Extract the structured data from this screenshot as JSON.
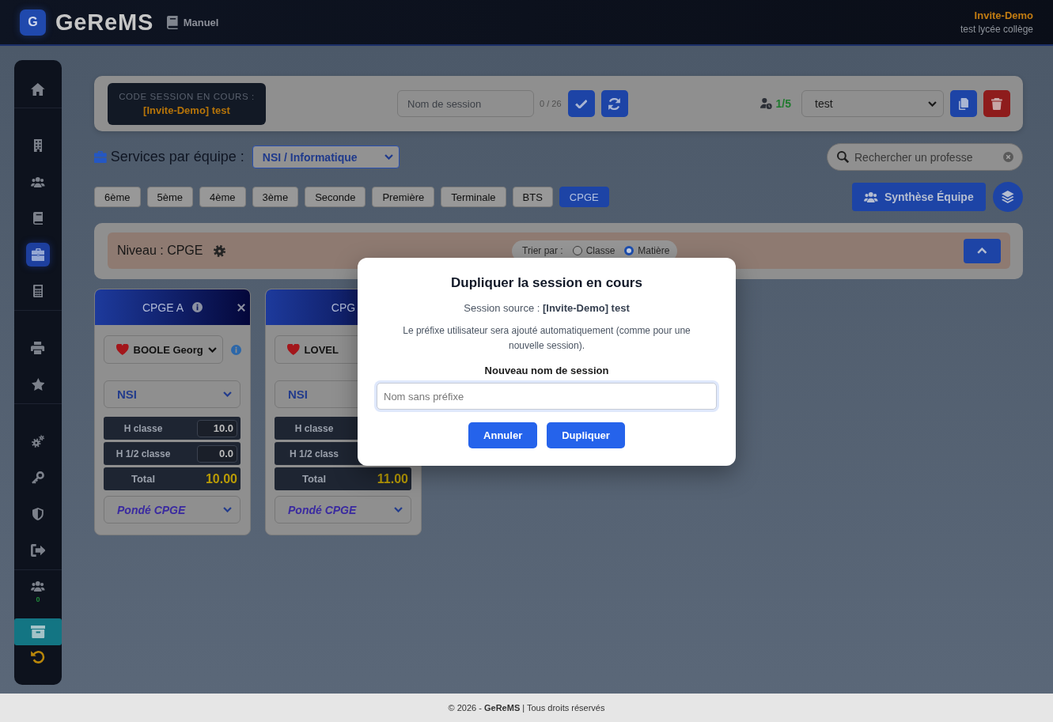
{
  "header": {
    "logo": "G",
    "app_name": "GeReMS",
    "manual_link": "Manuel",
    "user_name": "Invite-Demo",
    "school": "test lycée collège"
  },
  "sidebar": {
    "sections": [
      {
        "items": [
          {
            "kind": "plain",
            "selected": false
          }
        ]
      },
      {
        "items": [
          {
            "kind": "plain",
            "selected": false
          },
          {
            "kind": "plain",
            "selected": false
          },
          {
            "kind": "plain",
            "selected": false
          },
          {
            "kind": "plain",
            "selected": true
          },
          {
            "kind": "plain",
            "selected": false
          }
        ]
      },
      {
        "items": [
          {
            "kind": "plain",
            "selected": false
          },
          {
            "kind": "plain",
            "selected": false
          }
        ]
      },
      {
        "items": [
          {
            "kind": "plain",
            "selected": false
          },
          {
            "kind": "plain",
            "selected": false
          },
          {
            "kind": "plain",
            "selected": false
          },
          {
            "kind": "plain",
            "selected": false
          }
        ]
      },
      {
        "items": [
          {
            "kind": "plain",
            "selected": false,
            "count": "0"
          },
          {
            "kind": "tile",
            "selected": false
          },
          {
            "kind": "warn",
            "selected": false
          }
        ]
      }
    ]
  },
  "session_bar": {
    "code_label": "CODE SESSION EN COURS :",
    "code_value": "[Invite-Demo] test",
    "name_field": {
      "placeholder": "Nom de session"
    },
    "char_count": "0 / 26",
    "user_quota": "1/5",
    "session_select": {
      "value": "test"
    }
  },
  "services": {
    "title": "Services par équipe :",
    "team_select": {
      "value": "NSI / Informatique"
    },
    "search": {
      "placeholder": "Rechercher un professe"
    }
  },
  "level_tabs": [
    {
      "label": "6ème",
      "selected": false
    },
    {
      "label": "5ème",
      "selected": false
    },
    {
      "label": "4ème",
      "selected": false
    },
    {
      "label": "3ème",
      "selected": false
    },
    {
      "label": "Seconde",
      "selected": false
    },
    {
      "label": "Première",
      "selected": false
    },
    {
      "label": "Terminale",
      "selected": false
    },
    {
      "label": "BTS",
      "selected": false
    },
    {
      "label": "CPGE",
      "selected": true
    }
  ],
  "summary_button": "Synthèse Équipe",
  "level_panel": {
    "title": "Niveau : CPGE",
    "sort_label": "Trier par :",
    "sort_options": [
      {
        "label": "Classe",
        "selected": false
      },
      {
        "label": "Matière",
        "selected": true
      }
    ]
  },
  "cards": [
    {
      "title": "CPGE A",
      "info": true,
      "closable": true,
      "teacher": {
        "name": "BOOLE Georg",
        "favorite": true,
        "arrow": true,
        "info": true
      },
      "subject": {
        "value": "NSI",
        "arrow": true
      },
      "rows": [
        {
          "kind": "hours",
          "label": "H classe",
          "value": "10.0"
        },
        {
          "kind": "hours",
          "label": "H 1/2 classe",
          "value": "0.0"
        },
        {
          "kind": "total",
          "label": "Total",
          "value": "10.00"
        }
      ],
      "weighting": {
        "value": "Pondé CPGE",
        "arrow": true
      }
    },
    {
      "title": "CPG",
      "teacher": {
        "name": "LOVEL",
        "favorite": true
      },
      "subject": {
        "value": "NSI"
      },
      "rows": [
        {
          "kind": "hours",
          "label": "H classe"
        },
        {
          "kind": "hours",
          "label": "H 1/2 class"
        },
        {
          "kind": "total",
          "label": "Total",
          "value": "11.00"
        }
      ],
      "weighting": {
        "value": "Pondé CPGE",
        "arrow": true
      }
    }
  ],
  "dialog": {
    "title": "Dupliquer la session en cours",
    "source": "Session source : **[Invite-Demo] test**",
    "note": "Le préfixe utilisateur sera ajouté automatiquement (comme pour une nouvelle session).",
    "field_label": "Nouveau nom de session",
    "name_field": {
      "placeholder": "Nom sans préfixe",
      "focused": true
    },
    "buttons": [
      "Annuler",
      "Dupliquer"
    ]
  },
  "footer": "© 2026 - **GeReMS** | Tous droits réservés"
}
